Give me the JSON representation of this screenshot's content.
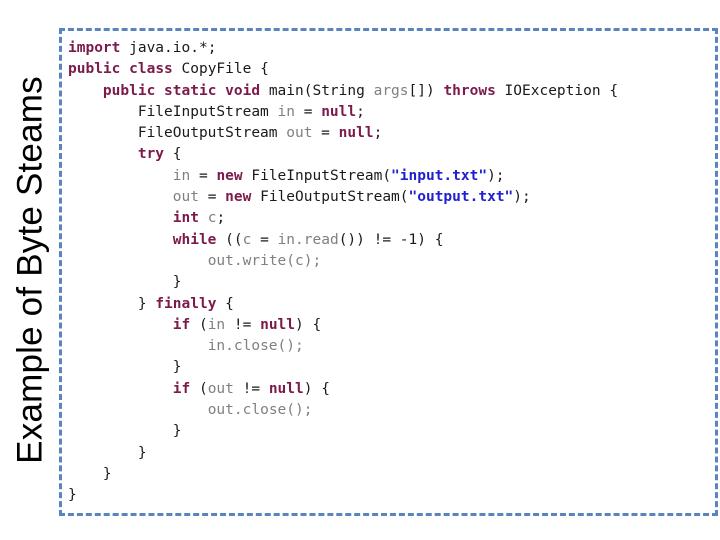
{
  "slide": {
    "title": "Example of Byte Steams",
    "background_color": "#ffffff"
  },
  "code_panel": {
    "border_color": "#5b84bd",
    "border_style": "dashed",
    "language": "java",
    "colors": {
      "keyword": "#7b1a4b",
      "identifier": "#808080",
      "type": "#1a1a1a",
      "string": "#2020d0",
      "plain": "#1a1a1a"
    },
    "lines": [
      [
        {
          "t": "import",
          "c": "kw"
        },
        {
          "t": " java.io.*;",
          "c": "ty"
        }
      ],
      [
        {
          "t": "public",
          "c": "kw"
        },
        {
          "t": " ",
          "c": "pn"
        },
        {
          "t": "class",
          "c": "kw"
        },
        {
          "t": " CopyFile {",
          "c": "ty"
        }
      ],
      [
        {
          "t": "    ",
          "c": "pn"
        },
        {
          "t": "public",
          "c": "kw"
        },
        {
          "t": " ",
          "c": "pn"
        },
        {
          "t": "static",
          "c": "kw"
        },
        {
          "t": " ",
          "c": "pn"
        },
        {
          "t": "void",
          "c": "kw"
        },
        {
          "t": " main(String ",
          "c": "ty"
        },
        {
          "t": "args",
          "c": "id"
        },
        {
          "t": "[]) ",
          "c": "ty"
        },
        {
          "t": "throws",
          "c": "kw"
        },
        {
          "t": " IOException {",
          "c": "ty"
        }
      ],
      [
        {
          "t": "        FileInputStream ",
          "c": "ty"
        },
        {
          "t": "in",
          "c": "id"
        },
        {
          "t": " = ",
          "c": "ty"
        },
        {
          "t": "null",
          "c": "kw"
        },
        {
          "t": ";",
          "c": "ty"
        }
      ],
      [
        {
          "t": "        FileOutputStream ",
          "c": "ty"
        },
        {
          "t": "out",
          "c": "id"
        },
        {
          "t": " = ",
          "c": "ty"
        },
        {
          "t": "null",
          "c": "kw"
        },
        {
          "t": ";",
          "c": "ty"
        }
      ],
      [
        {
          "t": "        ",
          "c": "pn"
        },
        {
          "t": "try",
          "c": "kw"
        },
        {
          "t": " {",
          "c": "ty"
        }
      ],
      [
        {
          "t": "            ",
          "c": "pn"
        },
        {
          "t": "in",
          "c": "id"
        },
        {
          "t": " = ",
          "c": "ty"
        },
        {
          "t": "new",
          "c": "kw"
        },
        {
          "t": " FileInputStream(",
          "c": "ty"
        },
        {
          "t": "\"input.txt\"",
          "c": "str"
        },
        {
          "t": ");",
          "c": "ty"
        }
      ],
      [
        {
          "t": "            ",
          "c": "pn"
        },
        {
          "t": "out",
          "c": "id"
        },
        {
          "t": " = ",
          "c": "ty"
        },
        {
          "t": "new",
          "c": "kw"
        },
        {
          "t": " FileOutputStream(",
          "c": "ty"
        },
        {
          "t": "\"output.txt\"",
          "c": "str"
        },
        {
          "t": ");",
          "c": "ty"
        }
      ],
      [
        {
          "t": "            ",
          "c": "pn"
        },
        {
          "t": "int",
          "c": "kw"
        },
        {
          "t": " ",
          "c": "pn"
        },
        {
          "t": "c",
          "c": "id"
        },
        {
          "t": ";",
          "c": "ty"
        }
      ],
      [
        {
          "t": "            ",
          "c": "pn"
        },
        {
          "t": "while",
          "c": "kw"
        },
        {
          "t": " ((",
          "c": "ty"
        },
        {
          "t": "c",
          "c": "id"
        },
        {
          "t": " = ",
          "c": "ty"
        },
        {
          "t": "in",
          "c": "id"
        },
        {
          "t": ".",
          "c": "id"
        },
        {
          "t": "read",
          "c": "id"
        },
        {
          "t": "()) != -1) {",
          "c": "ty"
        }
      ],
      [
        {
          "t": "                ",
          "c": "pn"
        },
        {
          "t": "out",
          "c": "id"
        },
        {
          "t": ".",
          "c": "id"
        },
        {
          "t": "write",
          "c": "id"
        },
        {
          "t": "(",
          "c": "id"
        },
        {
          "t": "c",
          "c": "id"
        },
        {
          "t": ");",
          "c": "id"
        }
      ],
      [
        {
          "t": "            }",
          "c": "ty"
        }
      ],
      [
        {
          "t": "        } ",
          "c": "ty"
        },
        {
          "t": "finally",
          "c": "kw"
        },
        {
          "t": " {",
          "c": "ty"
        }
      ],
      [
        {
          "t": "            ",
          "c": "pn"
        },
        {
          "t": "if",
          "c": "kw"
        },
        {
          "t": " (",
          "c": "ty"
        },
        {
          "t": "in",
          "c": "id"
        },
        {
          "t": " != ",
          "c": "ty"
        },
        {
          "t": "null",
          "c": "kw"
        },
        {
          "t": ") {",
          "c": "ty"
        }
      ],
      [
        {
          "t": "                ",
          "c": "pn"
        },
        {
          "t": "in",
          "c": "id"
        },
        {
          "t": ".",
          "c": "id"
        },
        {
          "t": "close",
          "c": "id"
        },
        {
          "t": "();",
          "c": "id"
        }
      ],
      [
        {
          "t": "            }",
          "c": "ty"
        }
      ],
      [
        {
          "t": "            ",
          "c": "pn"
        },
        {
          "t": "if",
          "c": "kw"
        },
        {
          "t": " (",
          "c": "ty"
        },
        {
          "t": "out",
          "c": "id"
        },
        {
          "t": " != ",
          "c": "ty"
        },
        {
          "t": "null",
          "c": "kw"
        },
        {
          "t": ") {",
          "c": "ty"
        }
      ],
      [
        {
          "t": "                ",
          "c": "pn"
        },
        {
          "t": "out",
          "c": "id"
        },
        {
          "t": ".",
          "c": "id"
        },
        {
          "t": "close",
          "c": "id"
        },
        {
          "t": "();",
          "c": "id"
        }
      ],
      [
        {
          "t": "            }",
          "c": "ty"
        }
      ],
      [
        {
          "t": "        }",
          "c": "ty"
        }
      ],
      [
        {
          "t": "    }",
          "c": "ty"
        }
      ],
      [
        {
          "t": "}",
          "c": "ty"
        }
      ]
    ],
    "plain_text": "import java.io.*;\npublic class CopyFile {\n    public static void main(String args[]) throws IOException {\n        FileInputStream in = null;\n        FileOutputStream out = null;\n        try {\n            in = new FileInputStream(\"input.txt\");\n            out = new FileOutputStream(\"output.txt\");\n            int c;\n            while ((c = in.read()) != -1) {\n                out.write(c);\n            }\n        } finally {\n            if (in != null) {\n                in.close();\n            }\n            if (out != null) {\n                out.close();\n            }\n        }\n    }\n}"
  }
}
